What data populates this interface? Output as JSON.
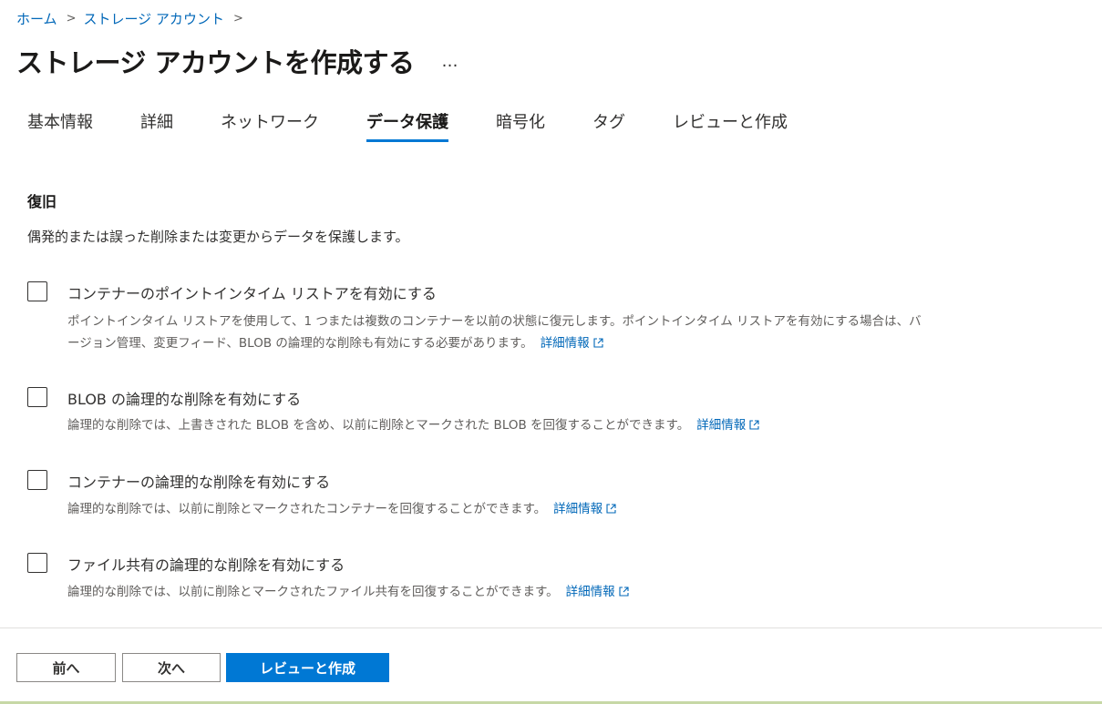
{
  "breadcrumb": {
    "items": [
      "ホーム",
      "ストレージ アカウント"
    ],
    "separator": ">"
  },
  "header": {
    "title": "ストレージ アカウントを作成する",
    "more_label": "…"
  },
  "tabs": [
    {
      "label": "基本情報",
      "active": false
    },
    {
      "label": "詳細",
      "active": false
    },
    {
      "label": "ネットワーク",
      "active": false
    },
    {
      "label": "データ保護",
      "active": true
    },
    {
      "label": "暗号化",
      "active": false
    },
    {
      "label": "タグ",
      "active": false
    },
    {
      "label": "レビューと作成",
      "active": false
    }
  ],
  "section": {
    "title": "復旧",
    "description": "偶発的または誤った削除または変更からデータを保護します。"
  },
  "options": [
    {
      "label": "コンテナーのポイントインタイム リストアを有効にする",
      "checked": false,
      "description": "ポイントインタイム リストアを使用して、1 つまたは複数のコンテナーを以前の状態に復元します。ポイントインタイム リストアを有効にする場合は、バージョン管理、変更フィード、BLOB の論理的な削除も有効にする必要があります。",
      "link": "詳細情報"
    },
    {
      "label": "BLOB の論理的な削除を有効にする",
      "checked": false,
      "description": "論理的な削除では、上書きされた BLOB を含め、以前に削除とマークされた BLOB を回復することができます。",
      "link": "詳細情報"
    },
    {
      "label": "コンテナーの論理的な削除を有効にする",
      "checked": false,
      "description": "論理的な削除では、以前に削除とマークされたコンテナーを回復することができます。",
      "link": "詳細情報"
    },
    {
      "label": "ファイル共有の論理的な削除を有効にする",
      "checked": false,
      "description": "論理的な削除では、以前に削除とマークされたファイル共有を回復することができます。",
      "link": "詳細情報"
    }
  ],
  "footer": {
    "prev_label": "前へ",
    "next_label": "次へ",
    "review_label": "レビューと作成"
  },
  "colors": {
    "accent": "#0078d4",
    "link": "#0067b8"
  },
  "icons": {
    "breadcrumb_separator": "chevron-right-icon",
    "external_link": "external-link-icon",
    "more": "more-icon"
  }
}
